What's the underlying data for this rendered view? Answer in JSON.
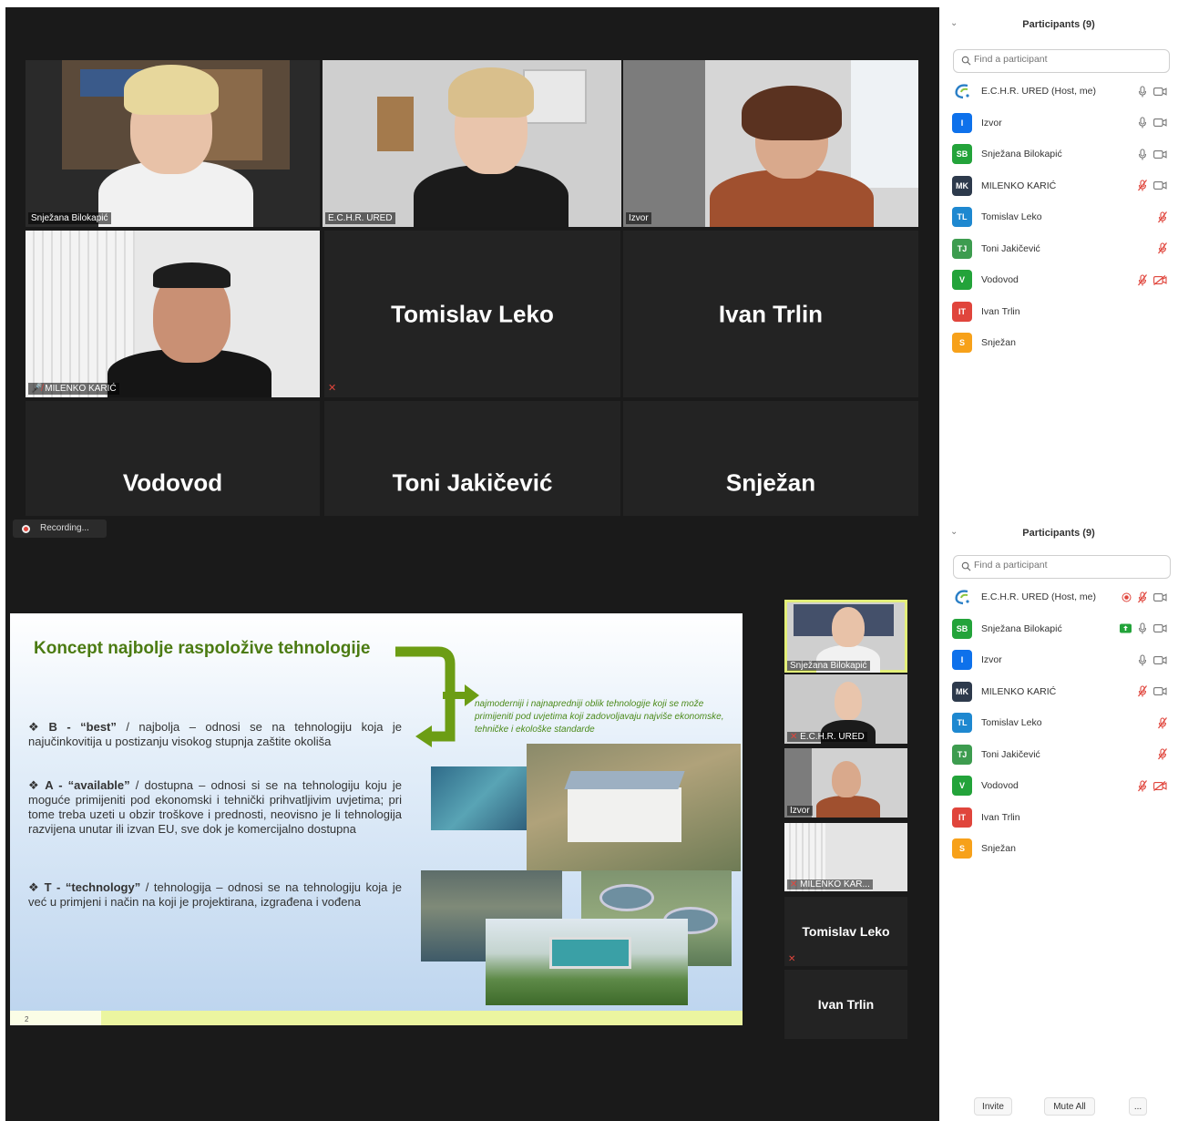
{
  "top": {
    "tiles": [
      {
        "name": "Snježana Bilokapić",
        "video": true
      },
      {
        "name": "E.C.H.R. URED",
        "video": true
      },
      {
        "name": "Izvor",
        "video": true
      },
      {
        "name": "MILENKO KARIĆ",
        "video": true
      },
      {
        "name": "Tomislav Leko",
        "video": false
      },
      {
        "name": "Ivan Trlin",
        "video": false
      },
      {
        "name": "Vodovod",
        "video": false
      },
      {
        "name": "Toni Jakičević",
        "video": false
      },
      {
        "name": "Snježan",
        "video": false
      }
    ],
    "panel": {
      "title": "Participants (9)",
      "search_placeholder": "Find a participant",
      "participants": [
        {
          "initials": "",
          "name": "E.C.H.R. URED (Host, me)",
          "color": "#ffffff",
          "logo": true,
          "mic": "on",
          "cam": "on"
        },
        {
          "initials": "I",
          "name": "Izvor",
          "color": "#0e71eb",
          "mic": "on",
          "cam": "on"
        },
        {
          "initials": "SB",
          "name": "Snježana Bilokapić",
          "color": "#23a33a",
          "mic": "on",
          "cam": "on"
        },
        {
          "initials": "MK",
          "name": "MILENKO KARIĆ",
          "color": "#2d3a4c",
          "mic": "off",
          "cam": "on"
        },
        {
          "initials": "TL",
          "name": "Tomislav Leko",
          "color": "#1e88d0",
          "mic": "off",
          "cam": "none"
        },
        {
          "initials": "TJ",
          "name": "Toni Jakičević",
          "color": "#3d9c4f",
          "mic": "off",
          "cam": "none"
        },
        {
          "initials": "V",
          "name": "Vodovod",
          "color": "#23a33a",
          "mic": "off",
          "cam": "off"
        },
        {
          "initials": "IT",
          "name": "Ivan Trlin",
          "color": "#e0453c",
          "mic": "none",
          "cam": "none"
        },
        {
          "initials": "S",
          "name": "Snježan",
          "color": "#f7a11a",
          "mic": "none",
          "cam": "none"
        }
      ]
    }
  },
  "bottom": {
    "recording_label": "Recording...",
    "slide": {
      "title": "Koncept najbolje raspoložive tehnologije",
      "note": "najmoderniji i najnapredniji oblik tehnologije koji se može primijeniti pod uvjetima koji zadovoljavaju najviše ekonomske, tehničke i ekološke standarde",
      "bullets": [
        {
          "key": "B - “best”",
          "text": " / najbolja – odnosi se na tehnologiju koja je najučinkovitija u postizanju visokog stupnja zaštite okoliša"
        },
        {
          "key": "A - “available”",
          "text": " / dostupna – odnosi si se na tehnologiju koju je moguće primijeniti pod ekonomski i tehnički prihvatljivim uvjetima; pri tome treba uzeti u obzir troškove i prednosti, neovisno je li tehnologija razvijena unutar ili izvan EU, sve dok je komercijalno dostupna"
        },
        {
          "key": "T - “technology”",
          "text": " / tehnologija – odnosi se na tehnologiju koja je već u primjeni i način na koji je projektirana, izgrađena i vođena"
        }
      ],
      "page_number": "2"
    },
    "thumbs": [
      {
        "name": "Snježana Bilokapić"
      },
      {
        "name": "E.C.H.R. URED"
      },
      {
        "name": "Izvor"
      },
      {
        "name": "MILENKO KAR..."
      },
      {
        "name": "Tomislav Leko"
      },
      {
        "name": "Ivan Trlin"
      }
    ],
    "panel": {
      "title": "Participants (9)",
      "search_placeholder": "Find a participant",
      "participants": [
        {
          "initials": "",
          "name": "E.C.H.R. URED (Host, me)",
          "color": "#ffffff",
          "logo": true,
          "rec": true,
          "mic": "off",
          "cam": "on"
        },
        {
          "initials": "SB",
          "name": "Snježana Bilokapić",
          "color": "#23a33a",
          "share": true,
          "mic": "on",
          "cam": "on"
        },
        {
          "initials": "I",
          "name": "Izvor",
          "color": "#0e71eb",
          "mic": "on",
          "cam": "on"
        },
        {
          "initials": "MK",
          "name": "MILENKO KARIĆ",
          "color": "#2d3a4c",
          "mic": "off",
          "cam": "on"
        },
        {
          "initials": "TL",
          "name": "Tomislav Leko",
          "color": "#1e88d0",
          "mic": "off",
          "cam": "none"
        },
        {
          "initials": "TJ",
          "name": "Toni Jakičević",
          "color": "#3d9c4f",
          "mic": "off",
          "cam": "none"
        },
        {
          "initials": "V",
          "name": "Vodovod",
          "color": "#23a33a",
          "mic": "off",
          "cam": "off"
        },
        {
          "initials": "IT",
          "name": "Ivan Trlin",
          "color": "#e0453c",
          "mic": "none",
          "cam": "none"
        },
        {
          "initials": "S",
          "name": "Snježan",
          "color": "#f7a11a",
          "mic": "none",
          "cam": "none"
        }
      ],
      "invite_label": "Invite",
      "mute_all_label": "Mute All",
      "more_label": "..."
    }
  }
}
